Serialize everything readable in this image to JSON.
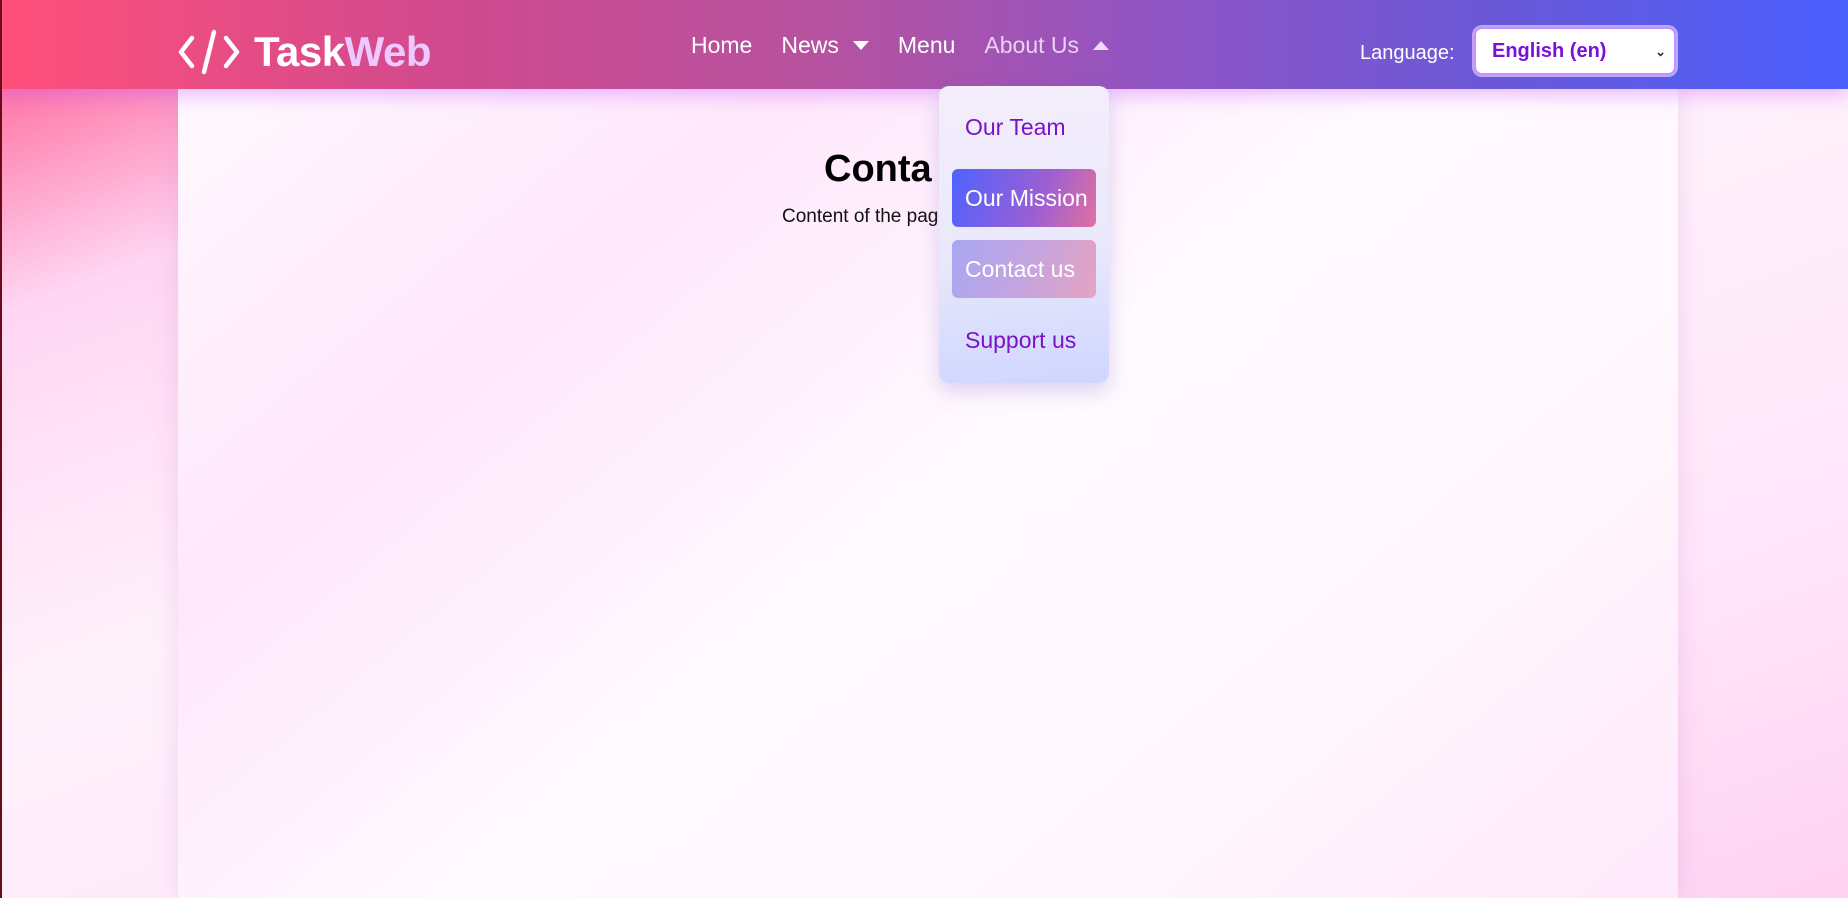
{
  "brand": {
    "part1": "Task",
    "part2": "Web",
    "icon": "code-icon"
  },
  "nav": {
    "home": "Home",
    "news": "News",
    "menu": "Menu",
    "about": "About Us"
  },
  "language": {
    "label": "Language:",
    "selected": "English (en)"
  },
  "main": {
    "title": "Conta",
    "text": "Content of the pag"
  },
  "about_dropdown": {
    "items": [
      {
        "label": "Our Team"
      },
      {
        "label": "Our Mission"
      },
      {
        "label": "Contact us"
      },
      {
        "label": "Support us"
      }
    ]
  },
  "colors": {
    "accent_purple": "#7a13c6",
    "header_start": "#ff4f7a",
    "header_end": "#4b60ff"
  }
}
